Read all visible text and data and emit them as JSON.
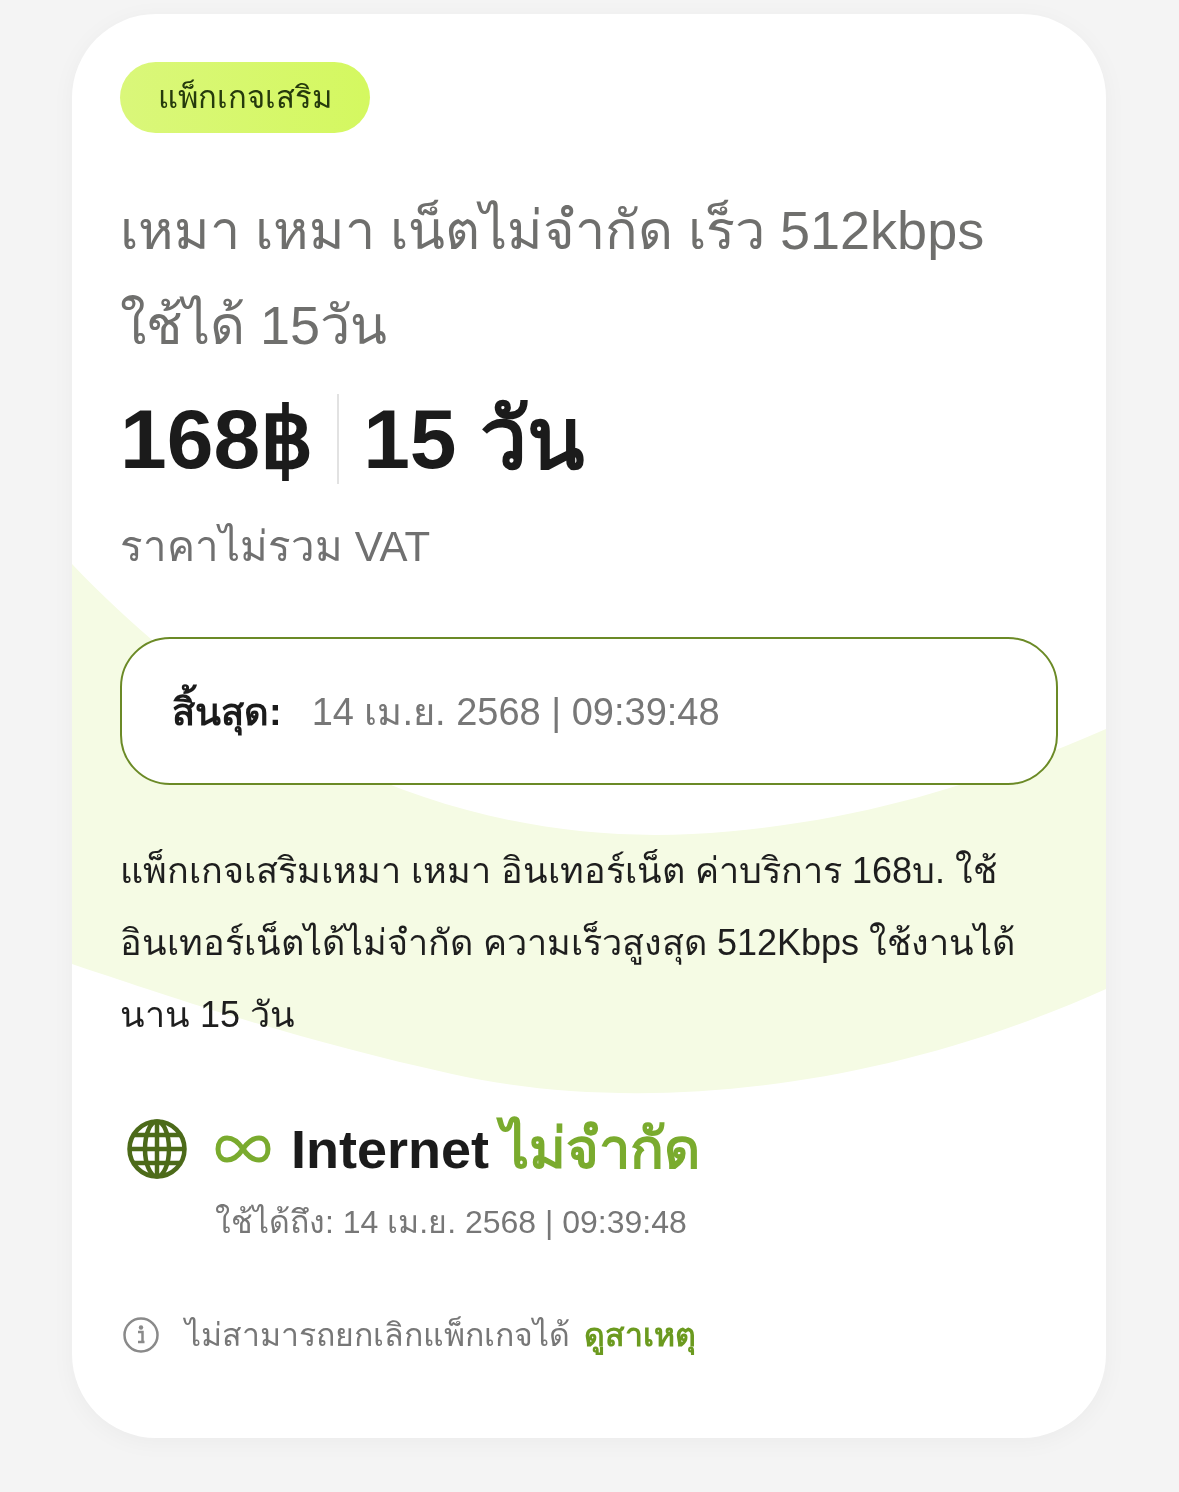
{
  "badge": {
    "label": "แพ็กเกจเสริม"
  },
  "title": "เหมา เหมา เน็ตไม่จำกัด เร็ว 512kbps ใช้ได้ 15วัน",
  "price": {
    "amount": "168฿",
    "duration": "15 วัน",
    "note": "ราคาไม่รวม VAT"
  },
  "expiry": {
    "label": "สิ้นสุด:",
    "value": "14 เม.ย. 2568 | 09:39:48"
  },
  "description": "แพ็กเกจเสริมเหมา เหมา อินเทอร์เน็ต ค่าบริการ 168บ. ใช้อินเทอร์เน็ตได้ไม่จำกัด ความเร็วสูงสุด 512Kbps ใช้งานได้นาน 15 วัน",
  "quotas": [
    {
      "kind": "internet",
      "name": "Internet",
      "amount": "ไม่จำกัด",
      "valid_until": "ใช้ได้ถึง: 14 เม.ย. 2568 | 09:39:48"
    }
  ],
  "notice": {
    "text": "ไม่สามารถยกเลิกแพ็กเกจได้",
    "link": "ดูสาเหตุ"
  }
}
